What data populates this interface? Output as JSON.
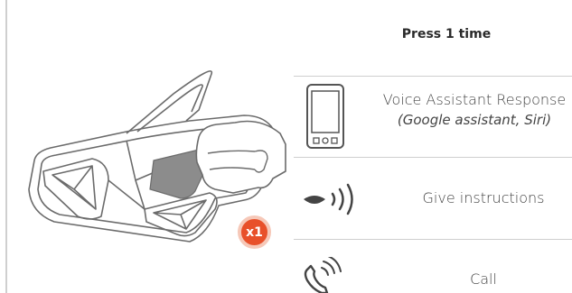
{
  "header": {
    "title": "Press 1 time"
  },
  "badge": {
    "label": "x1"
  },
  "rows": [
    {
      "icon": "smartphone-icon",
      "label": "Voice Assistant Response",
      "sublabel": "(Google assistant, Siri)"
    },
    {
      "icon": "speaking-mouth-icon",
      "label": "Give instructions"
    },
    {
      "icon": "phone-call-icon",
      "label": "Call"
    }
  ],
  "colors": {
    "badge": "#e8502a",
    "badge_ring": "#f6c8b8",
    "rule": "#cfcfcf",
    "line_art": "#6b6b6b",
    "button_fill": "#8c8c8c"
  }
}
